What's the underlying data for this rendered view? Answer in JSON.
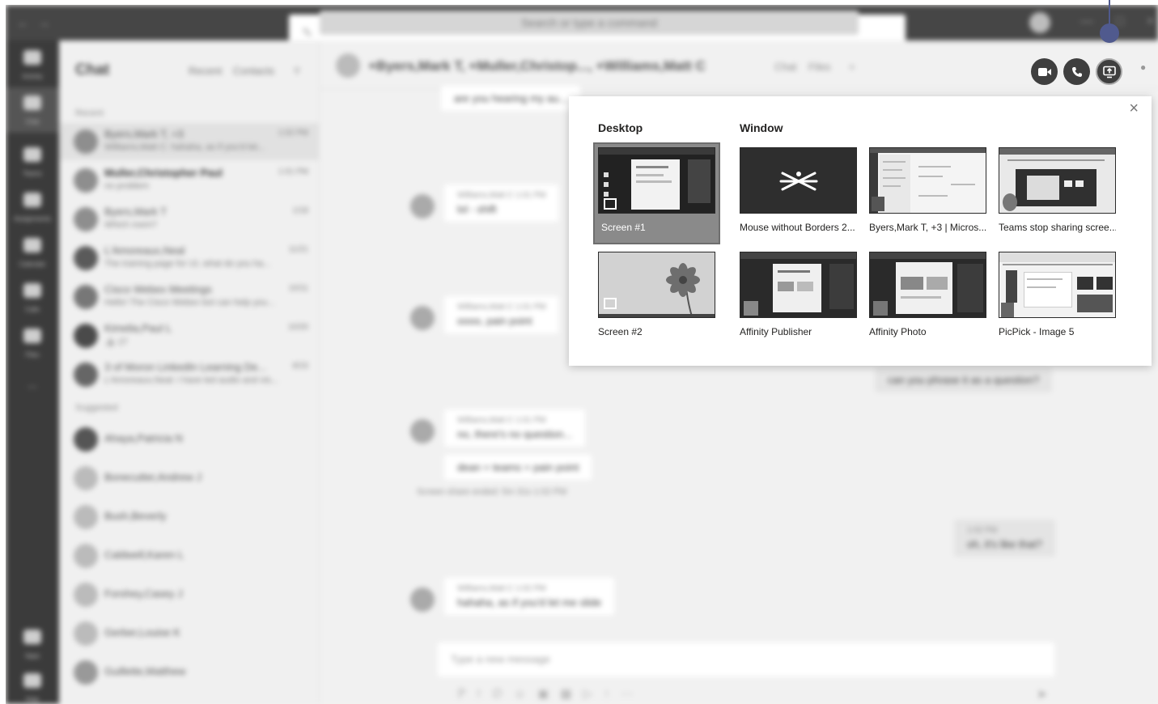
{
  "topbar": {
    "search_placeholder": "Search or type a command"
  },
  "rail": {
    "items": [
      "Activity",
      "Chat",
      "Teams",
      "Assignments",
      "Calendar",
      "Calls",
      "Files",
      "...",
      "Apps",
      "Help"
    ]
  },
  "chatlist": {
    "title": "Chat",
    "tabs": [
      "Recent",
      "Contacts"
    ],
    "section_recent": "Recent",
    "section_suggested": "Suggested",
    "items": [
      {
        "name": "Byers,Mark T, +3",
        "preview": "Williams,Matt C: hahaha, as if you'd let...",
        "time": "1:02 PM"
      },
      {
        "name": "Muller,Christopher Paul",
        "preview": "no problem",
        "time": "1:01 PM"
      },
      {
        "name": "Byers,Mark T",
        "preview": "Which room?",
        "time": "1/18"
      },
      {
        "name": "L'Amoreaux,Neal",
        "preview": "The training page for UI, what do you ha...",
        "time": "11/21"
      },
      {
        "name": "Cisco Webex Meetings",
        "preview": "Hello! The Cisco Webex bot can help you...",
        "time": "10/11"
      },
      {
        "name": "Kimelia,Paul L",
        "preview": "👍 27",
        "time": "10/20"
      },
      {
        "name": "3 of Moron LinkedIn Learning De...",
        "preview": "L'Amoreaux,Neal: I have led audio and vis...",
        "time": "8/15"
      }
    ],
    "suggested": [
      "Ahaya,Patricia N",
      "Bonecutter,Andrew J",
      "Bush,Beverly",
      "Caldwell,Karen L",
      "Forshey,Casey J",
      "Gerber,Louise K",
      "Guillette,Matthew"
    ]
  },
  "conversation": {
    "title": "+Byers,Mark T, +Muller,Christop..., +Williams,Matt C",
    "tabs": [
      "Chat",
      "Files",
      "+"
    ],
    "messages": [
      {
        "meta": "",
        "text": "are you hearing my au..."
      },
      {
        "meta": "Williams,Matt C  1:01 PM",
        "text": "lol - shift"
      },
      {
        "meta": "Williams,Matt C  1:01 PM",
        "text": "oooo, pain point"
      },
      {
        "meta": "",
        "text": "can you phrase it as a question?"
      },
      {
        "meta": "Williams,Matt C  1:01 PM",
        "text": "no, there's no question..."
      },
      {
        "meta": "",
        "text": "dean = teams = pain point"
      },
      {
        "meta": "",
        "text": "Screen share ended: 5m 31s  1:02 PM"
      },
      {
        "meta": "1:02 PM",
        "text": "oh, it's like that?"
      },
      {
        "meta": "Williams,Matt C  1:02 PM",
        "text": "hahaha, as if you'd let me slide"
      }
    ],
    "compose_placeholder": "Type a new message"
  },
  "share_panel": {
    "desktop_label": "Desktop",
    "window_label": "Window",
    "screens": [
      "Screen #1",
      "Screen #2"
    ],
    "windows": [
      "Mouse without Borders 2...",
      "Byers,Mark T, +3 | Micros...",
      "Teams stop sharing scree...",
      "Affinity Publisher",
      "Affinity Photo",
      "PicPick - Image 5"
    ],
    "close_symbol": "×"
  },
  "call_controls": [
    "video-call",
    "audio-call",
    "share-screen"
  ],
  "colors": {
    "indicator": "#505a8e",
    "button": "#3f3f3f"
  }
}
